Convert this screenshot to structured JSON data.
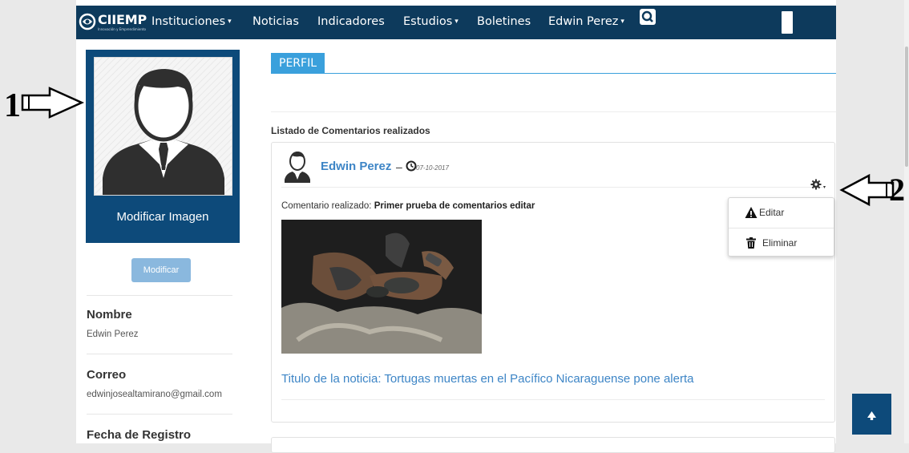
{
  "navbar": {
    "brand": "CIIEMP",
    "brand_sub": "Innovación y Emprendimiento",
    "items": [
      {
        "label": "Instituciones",
        "caret": "▾"
      },
      {
        "label": "Noticias"
      },
      {
        "label": "Indicadores"
      },
      {
        "label": "Estudios",
        "caret": "▾"
      },
      {
        "label": "Boletines"
      },
      {
        "label": "Edwin Perez",
        "caret": "▾"
      }
    ]
  },
  "annotations": {
    "arrow_one": "1",
    "arrow_two": "2"
  },
  "sidebar": {
    "modify_image_label": "Modificar Imagen",
    "modify_button": "Modificar",
    "fields": [
      {
        "label": "Nombre",
        "value": "Edwin Perez"
      },
      {
        "label": "Correo",
        "value": "edwinjosealtamirano@gmail.com"
      },
      {
        "label": "Fecha de Registro",
        "value": ""
      }
    ]
  },
  "main": {
    "tab": "PERFIL",
    "list_heading": "Listado de Comentarios realizados",
    "comment": {
      "author": "Edwin Perez",
      "dash": "–",
      "date": "07-10-2017",
      "text_prefix": "Comentario realizado: ",
      "text_value": "Primer prueba de comentarios editar",
      "news_title": "Titulo de la noticia: Tortugas muertas en el Pacífico Nicaraguense pone alerta"
    },
    "dropdown": [
      {
        "label": "Editar",
        "icon": "warning-icon"
      },
      {
        "label": "Eliminar",
        "icon": "trash-icon"
      }
    ]
  },
  "colors": {
    "navbar": "#0d3a5c",
    "accent": "#3aa0dc",
    "profile_box": "#0d4a7a",
    "link": "#3d85c6"
  }
}
